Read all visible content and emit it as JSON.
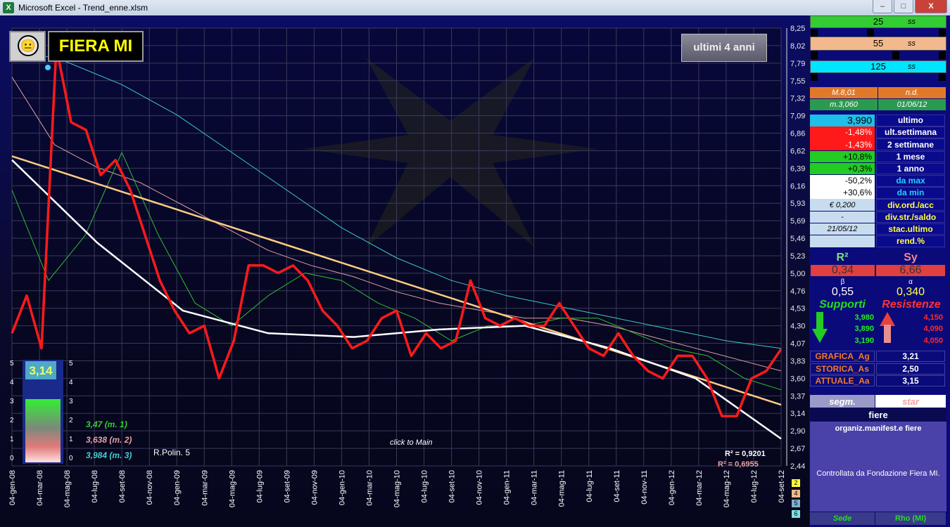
{
  "window": {
    "title": "Microsoft Excel - Trend_enne.xlsm",
    "app_icon": "X",
    "btn_min": "–",
    "btn_max": "□",
    "btn_close": "X"
  },
  "header": {
    "ticker": "FIERA MI",
    "smiley": "😐",
    "range_button": "ultimi 4 anni"
  },
  "chart_data": {
    "type": "line",
    "x": [
      "04-gen-08",
      "04-mar-08",
      "04-mag-08",
      "04-lug-08",
      "04-set-08",
      "04-nov-08",
      "04-gen-09",
      "04-mar-09",
      "04-mag-09",
      "04-lug-09",
      "04-set-09",
      "04-nov-09",
      "04-gen-10",
      "04-mar-10",
      "04-mag-10",
      "04-lug-10",
      "04-set-10",
      "04-nov-10",
      "04-gen-11",
      "04-mar-11",
      "04-mag-11",
      "04-lug-11",
      "04-set-11",
      "04-nov-11",
      "04-gen-12",
      "04-mar-12",
      "04-mag-12",
      "04-lug-12",
      "04-set-12"
    ],
    "yticks": [
      "8,25",
      "8,02",
      "7,79",
      "7,55",
      "7,32",
      "7,09",
      "6,86",
      "6,62",
      "6,39",
      "6,16",
      "5,93",
      "5,69",
      "5,46",
      "5,23",
      "5,00",
      "4,76",
      "4,53",
      "4,30",
      "4,07",
      "3,83",
      "3,60",
      "3,37",
      "3,14",
      "2,90",
      "2,67",
      "2,44"
    ],
    "ylim": [
      2.44,
      8.25
    ],
    "series": [
      {
        "color": "#ff1a1a",
        "values": [
          4.2,
          4.7,
          4.0,
          8.0,
          7.0,
          6.9,
          6.3,
          6.5,
          6.1,
          5.5,
          4.9,
          4.5,
          4.2,
          4.3,
          3.6,
          4.1,
          5.1,
          5.1,
          5.0,
          5.1,
          4.9,
          4.5,
          4.3,
          4.0,
          4.1,
          4.4,
          4.5,
          3.9,
          4.2,
          4.0,
          4.1,
          4.9,
          4.4,
          4.3,
          4.4,
          4.3,
          4.3,
          4.6,
          4.3,
          4.0,
          3.9,
          4.2,
          3.9,
          3.7,
          3.6,
          3.9,
          3.9,
          3.6,
          3.1,
          3.1,
          3.6,
          3.7,
          3.99
        ]
      },
      {
        "color": "#ffcc80",
        "values": [
          6.55,
          3.25
        ]
      },
      {
        "color": "#ffffff",
        "values": [
          6.5,
          5.4,
          4.5,
          4.2,
          4.15,
          4.25,
          4.3,
          4.0,
          3.6,
          2.8
        ]
      },
      {
        "color": "#30c030",
        "values": [
          6.1,
          4.9,
          5.5,
          6.6,
          5.5,
          4.6,
          4.3,
          4.7,
          5.0,
          4.9,
          4.6,
          4.4,
          4.1,
          4.3,
          4.3,
          4.4,
          4.4,
          4.2,
          4.0,
          3.9,
          3.6,
          3.45
        ]
      },
      {
        "color": "#e0a0a0",
        "values": [
          7.6,
          6.7,
          6.4,
          6.2,
          5.9,
          5.6,
          5.3,
          5.1,
          4.95,
          4.75,
          4.6,
          4.5,
          4.4,
          4.4,
          4.3,
          4.15,
          4.0,
          3.85,
          3.7
        ]
      },
      {
        "color": "#40c8c8",
        "values": [
          8.0,
          7.8,
          7.5,
          7.1,
          6.6,
          6.1,
          5.6,
          5.2,
          4.9,
          4.7,
          4.55,
          4.4,
          4.25,
          4.1,
          4.0
        ]
      }
    ],
    "annotations": {
      "r2_a": "R² = 0,9201",
      "r2_b": "R² = 0,6955",
      "polin": "R.Polin.  5",
      "click": "click to Main"
    }
  },
  "legend": {
    "m1": "3,47   (m. 1)",
    "m2": "3,638  (m. 2)",
    "m3": "3,984  (m. 3)"
  },
  "gauge": {
    "value": "3,14",
    "ticks": [
      "5",
      "4",
      "3",
      "2",
      "1",
      "0"
    ]
  },
  "side_tabs": [
    "2",
    "4",
    "5",
    "6"
  ],
  "panel": {
    "slider1": {
      "value": "25",
      "unit": "ss",
      "color": "#33cc33"
    },
    "slider2": {
      "value": "55",
      "unit": "ss",
      "color": "#f2b98c"
    },
    "slider3": {
      "value": "125",
      "unit": "ss",
      "color": "#00e5ff"
    },
    "max_label": "M.8,01",
    "max_val": "n.d.",
    "min_label": "m.3,060",
    "min_date": "01/06/12",
    "perf": [
      {
        "value": "3,990",
        "label": "ultimo",
        "bg": "#1cc0e8",
        "fg": "#000"
      },
      {
        "value": "-1,48%",
        "label": "ult.settimana",
        "bg": "#ff1a1a",
        "fg": "#fff"
      },
      {
        "value": "-1,43%",
        "label": "2 settimane",
        "bg": "#ff1a1a",
        "fg": "#fff"
      },
      {
        "value": "+10,8%",
        "label": "1 mese",
        "bg": "#22cc22",
        "fg": "#000"
      },
      {
        "value": "+0,3%",
        "label": "1 anno",
        "bg": "#22cc22",
        "fg": "#000"
      },
      {
        "value": "-50,2%",
        "label": "da max",
        "bg": "#ffffff",
        "fg": "#000"
      },
      {
        "value": "+30,6%",
        "label": "da min",
        "bg": "#ffffff",
        "fg": "#000"
      },
      {
        "value": "€ 0,200",
        "label": "div.ord./acc",
        "bg": "#c8dcf0",
        "fg": "#000"
      },
      {
        "value": "-",
        "label": "div.str./saldo",
        "bg": "#c8dcf0",
        "fg": "#000"
      },
      {
        "value": "21/05/12",
        "label": "stac.ultimo",
        "bg": "#c8dcf0",
        "fg": "#000"
      },
      {
        "value": "",
        "label": "rend.%",
        "bg": "#c8dcf0",
        "fg": "#000"
      }
    ],
    "stats": {
      "r2_head": "R²",
      "sy_head": "Sy",
      "r2": "0,34",
      "sy": "6,66",
      "beta_head": "β",
      "alpha_head": "α",
      "beta": "0,55",
      "alpha": "0,340"
    },
    "sr": {
      "supp_head": "Supporti",
      "res_head": "Resistenze",
      "supp": [
        "3,980",
        "3,890",
        "3,190"
      ],
      "res": [
        "4,150",
        "4,090",
        "4,050"
      ]
    },
    "grades": [
      {
        "label": "GRAFICA_Ag",
        "value": "3,21"
      },
      {
        "label": "STORICA_As",
        "value": "2,50"
      },
      {
        "label": "ATTUALE_Aa",
        "value": "3,15"
      }
    ],
    "segm": "segm.",
    "star": "star",
    "sector": "fiere",
    "subsector": "organiz.manifest.e fiere",
    "description": "Controllata da Fondazione Fiera MI.",
    "sede_label": "Sede",
    "sede_value": "Rho (MI)"
  }
}
